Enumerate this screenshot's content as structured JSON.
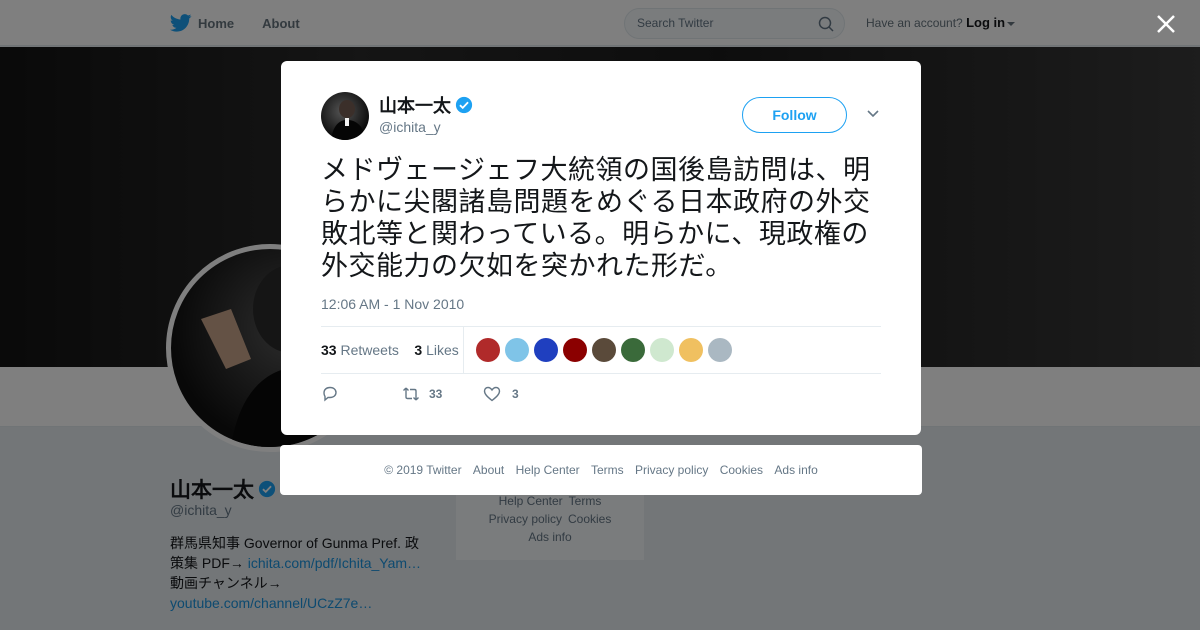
{
  "nav": {
    "home_label": "Home",
    "about_label": "About",
    "search_placeholder": "Search Twitter",
    "account_prompt": "Have an account?",
    "login_label": "Log in"
  },
  "background_profile": {
    "name": "山本一太",
    "handle": "@ichita_y",
    "bio_line1": "群馬県知事 Governor of Gunma Pref. 政",
    "bio_line2_prefix": "策集 PDF→ ",
    "bio_link1": "ichita.com/pdf/Ichita_Yam…",
    "bio_line3": "動画チャンネル→",
    "bio_link2": "youtube.com/channel/UCzZ7e…",
    "footer_links": [
      "Help Center",
      "Terms",
      "Privacy policy",
      "Cookies",
      "Ads info"
    ]
  },
  "tweet": {
    "author_name": "山本一太",
    "author_handle": "@ichita_y",
    "follow_label": "Follow",
    "text": "メドヴェージェフ大統領の国後島訪問は、明らかに尖閣諸島問題をめぐる日本政府の外交敗北等と関わっている。明らかに、現政権の外交能力の欠如を突かれた形だ。",
    "timestamp": "12:06 AM - 1 Nov 2010",
    "retweets_count": "33",
    "retweets_label": "Retweets",
    "likes_count": "3",
    "likes_label": "Likes",
    "likers_colors": [
      "#b02a2a",
      "#7fc4e8",
      "#1f3fbf",
      "#8b0000",
      "#5a4a3a",
      "#3a6a3a",
      "#cfe8cf",
      "#f0c060",
      "#aab8c2"
    ],
    "action_retweet_count": "33",
    "action_like_count": "3"
  },
  "footer": {
    "copyright": "© 2019 Twitter",
    "links": [
      "About",
      "Help Center",
      "Terms",
      "Privacy policy",
      "Cookies",
      "Ads info"
    ]
  },
  "colors": {
    "accent": "#1da1f2",
    "verified": "#1da1f2",
    "muted": "#657786"
  }
}
